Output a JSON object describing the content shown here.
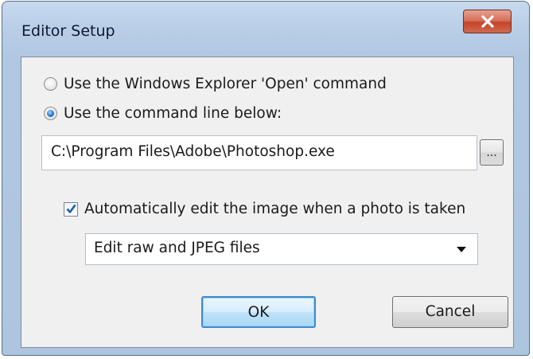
{
  "dialog": {
    "title": "Editor Setup",
    "close_icon": "close-x-icon"
  },
  "options": {
    "radio_explorer_label": "Use the Windows Explorer 'Open' command",
    "radio_explorer_selected": false,
    "radio_command_label": "Use the command line below:",
    "radio_command_selected": true
  },
  "command": {
    "path_value": "C:\\Program Files\\Adobe\\Photoshop.exe",
    "browse_label": "..."
  },
  "auto_edit": {
    "label": "Automatically edit the image when a photo is taken",
    "checked": true,
    "mode_value": "Edit raw and JPEG files",
    "dropdown_icon": "chevron-down-icon"
  },
  "buttons": {
    "ok_label": "OK",
    "cancel_label": "Cancel"
  },
  "colors": {
    "close_button": "#c4452b",
    "default_button_border": "#3c8bd0",
    "frame": "#b7cde6"
  }
}
